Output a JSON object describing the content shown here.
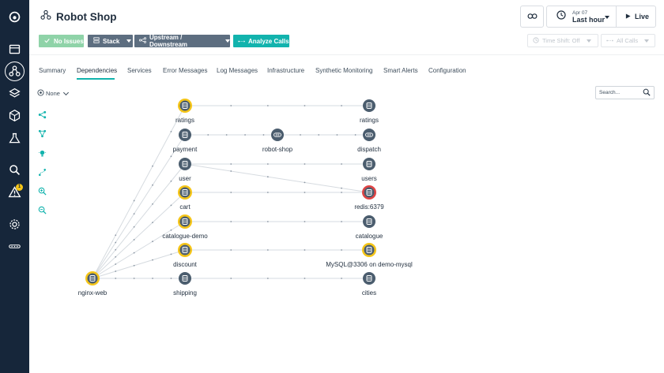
{
  "app": {
    "title": "Robot Shop",
    "title_icon": "application-icon"
  },
  "toolbar": {
    "no_issues_label": "No Issues",
    "stack_label": "Stack",
    "upstream_label": "Upstream / Downstream",
    "analyze_label": "Analyze Calls",
    "time_shift_label": "Time Shift: Off",
    "all_calls_label": "All Calls"
  },
  "timerange": {
    "date": "Apr 07",
    "label": "Last hour",
    "live_label": "Live"
  },
  "tabs": [
    {
      "label": "Summary",
      "active": false
    },
    {
      "label": "Dependencies",
      "active": true
    },
    {
      "label": "Services",
      "active": false
    },
    {
      "label": "Error Messages",
      "active": false
    },
    {
      "label": "Log Messages",
      "active": false
    },
    {
      "label": "Infrastructure",
      "active": false
    },
    {
      "label": "Synthetic Monitoring",
      "active": false
    },
    {
      "label": "Smart Alerts",
      "active": false
    },
    {
      "label": "Configuration",
      "active": false
    }
  ],
  "map": {
    "grouping_label": "None",
    "search_placeholder": "Search..."
  },
  "sidebar": {
    "alert_count": "1"
  },
  "colors": {
    "rail": "#16263a",
    "accent": "#12b3ad",
    "node_dark": "#4b5d6e",
    "warning_ring": "#f5c518",
    "critical_ring": "#e04444"
  },
  "nodes": [
    {
      "id": "ratings-svc",
      "label": "ratings",
      "kind": "service",
      "status": "warning"
    },
    {
      "id": "ratings-db",
      "label": "ratings",
      "kind": "database",
      "status": "ok"
    },
    {
      "id": "payment",
      "label": "payment",
      "kind": "service",
      "status": "ok"
    },
    {
      "id": "robot-shop",
      "label": "robot-shop",
      "kind": "queue",
      "status": "ok"
    },
    {
      "id": "dispatch",
      "label": "dispatch",
      "kind": "queue",
      "status": "ok"
    },
    {
      "id": "user",
      "label": "user",
      "kind": "service",
      "status": "ok"
    },
    {
      "id": "users",
      "label": "users",
      "kind": "database",
      "status": "ok"
    },
    {
      "id": "cart",
      "label": "cart",
      "kind": "service",
      "status": "warning"
    },
    {
      "id": "redis",
      "label": "redis:6379",
      "kind": "database",
      "status": "critical"
    },
    {
      "id": "catalogue-demo",
      "label": "catalogue-demo",
      "kind": "service",
      "status": "warning"
    },
    {
      "id": "catalogue",
      "label": "catalogue",
      "kind": "database",
      "status": "ok"
    },
    {
      "id": "discount",
      "label": "discount",
      "kind": "service",
      "status": "warning"
    },
    {
      "id": "mysql",
      "label": "MySQL@3306 on demo-mysql",
      "kind": "database",
      "status": "warning"
    },
    {
      "id": "nginx-web",
      "label": "nginx-web",
      "kind": "service",
      "status": "warning"
    },
    {
      "id": "shipping",
      "label": "shipping",
      "kind": "service",
      "status": "ok"
    },
    {
      "id": "cities",
      "label": "cities",
      "kind": "database",
      "status": "ok"
    }
  ],
  "edges": [
    [
      "ratings-svc",
      "ratings-db"
    ],
    [
      "payment",
      "robot-shop"
    ],
    [
      "robot-shop",
      "dispatch"
    ],
    [
      "user",
      "users"
    ],
    [
      "user",
      "redis"
    ],
    [
      "cart",
      "redis"
    ],
    [
      "catalogue-demo",
      "catalogue"
    ],
    [
      "discount",
      "mysql"
    ],
    [
      "shipping",
      "cities"
    ],
    [
      "nginx-web",
      "ratings-svc"
    ],
    [
      "nginx-web",
      "payment"
    ],
    [
      "nginx-web",
      "user"
    ],
    [
      "nginx-web",
      "cart"
    ],
    [
      "nginx-web",
      "catalogue-demo"
    ],
    [
      "nginx-web",
      "discount"
    ],
    [
      "nginx-web",
      "shipping"
    ]
  ]
}
